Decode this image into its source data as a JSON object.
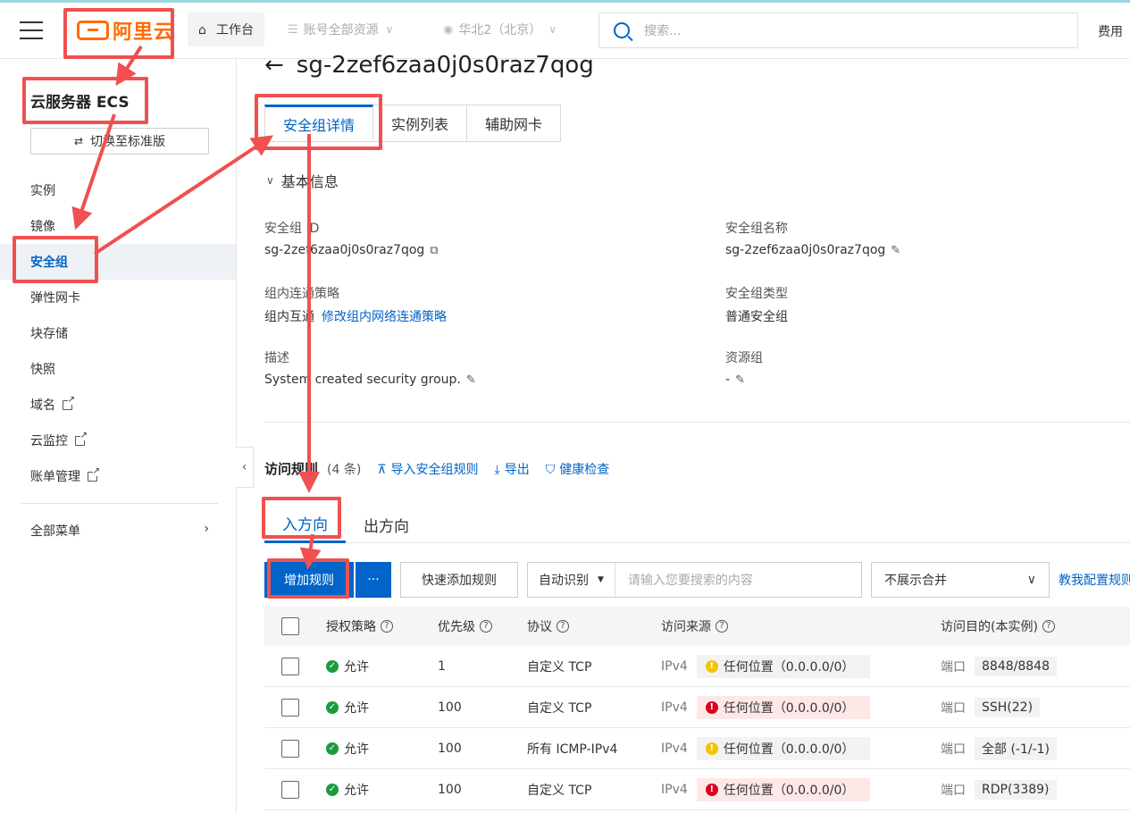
{
  "header": {
    "logo_text": "阿里云",
    "workbench": "工作台",
    "resource_scope": "账号全部资源",
    "region": "华北2（北京）",
    "search_placeholder": "搜索...",
    "fee": "费用"
  },
  "sidebar": {
    "product": "云服务器 ECS",
    "switch_label": "切换至标准版",
    "items": [
      {
        "label": "实例"
      },
      {
        "label": "镜像"
      },
      {
        "label": "安全组"
      },
      {
        "label": "弹性网卡"
      },
      {
        "label": "块存储"
      },
      {
        "label": "快照"
      },
      {
        "label": "域名"
      },
      {
        "label": "云监控"
      },
      {
        "label": "账单管理"
      }
    ],
    "all_menu": "全部菜单"
  },
  "page": {
    "title": "sg-2zef6zaa0j0s0raz7qog",
    "tabs": [
      "安全组详情",
      "实例列表",
      "辅助网卡"
    ],
    "basic_info": "基本信息",
    "fields": {
      "sg_id_label": "安全组 ID",
      "sg_id_value": "sg-2zef6zaa0j0s0raz7qog",
      "sg_name_label": "安全组名称",
      "sg_name_value": "sg-2zef6zaa0j0s0raz7qog",
      "policy_label": "组内连通策略",
      "policy_value": "组内互通",
      "policy_link": "修改组内网络连通策略",
      "type_label": "安全组类型",
      "type_value": "普通安全组",
      "desc_label": "描述",
      "desc_value": "System created security group.",
      "rg_label": "资源组",
      "rg_value": "-"
    }
  },
  "rules": {
    "title": "访问规则",
    "count": "(4 条)",
    "import_link": "导入安全组规则",
    "export_link": "导出",
    "health_link": "健康检查",
    "direction_tabs": [
      "入方向",
      "出方向"
    ],
    "add_rule": "增加规则",
    "more": "···",
    "quick_add": "快速添加规则",
    "auto_detect": "自动识别",
    "search_placeholder": "请输入您要搜索的内容",
    "merge_select": "不展示合并",
    "teach_link": "教我配置规则",
    "columns": {
      "policy": "授权策略",
      "priority": "优先级",
      "protocol": "协议",
      "source": "访问来源",
      "dest": "访问目的(本实例)"
    },
    "rows": [
      {
        "policy": "允许",
        "priority": "1",
        "protocol": "自定义 TCP",
        "ipver": "IPv4",
        "source": "任何位置（0.0.0.0/0）",
        "level": "warn",
        "port_label": "端口",
        "port": "8848/8848"
      },
      {
        "policy": "允许",
        "priority": "100",
        "protocol": "自定义 TCP",
        "ipver": "IPv4",
        "source": "任何位置（0.0.0.0/0）",
        "level": "danger",
        "port_label": "端口",
        "port": "SSH(22)"
      },
      {
        "policy": "允许",
        "priority": "100",
        "protocol": "所有 ICMP-IPv4",
        "ipver": "IPv4",
        "source": "任何位置（0.0.0.0/0）",
        "level": "warn",
        "port_label": "端口",
        "port": "全部 (-1/-1)"
      },
      {
        "policy": "允许",
        "priority": "100",
        "protocol": "自定义 TCP",
        "ipver": "IPv4",
        "source": "任何位置（0.0.0.0/0）",
        "level": "danger",
        "port_label": "端口",
        "port": "RDP(3389)"
      }
    ]
  },
  "colors": {
    "accent": "#0064c8",
    "brand": "#ff6a00",
    "annotation": "#f05050",
    "allow": "#1a9c3e",
    "warn": "#f5c400",
    "danger": "#d9001b"
  }
}
